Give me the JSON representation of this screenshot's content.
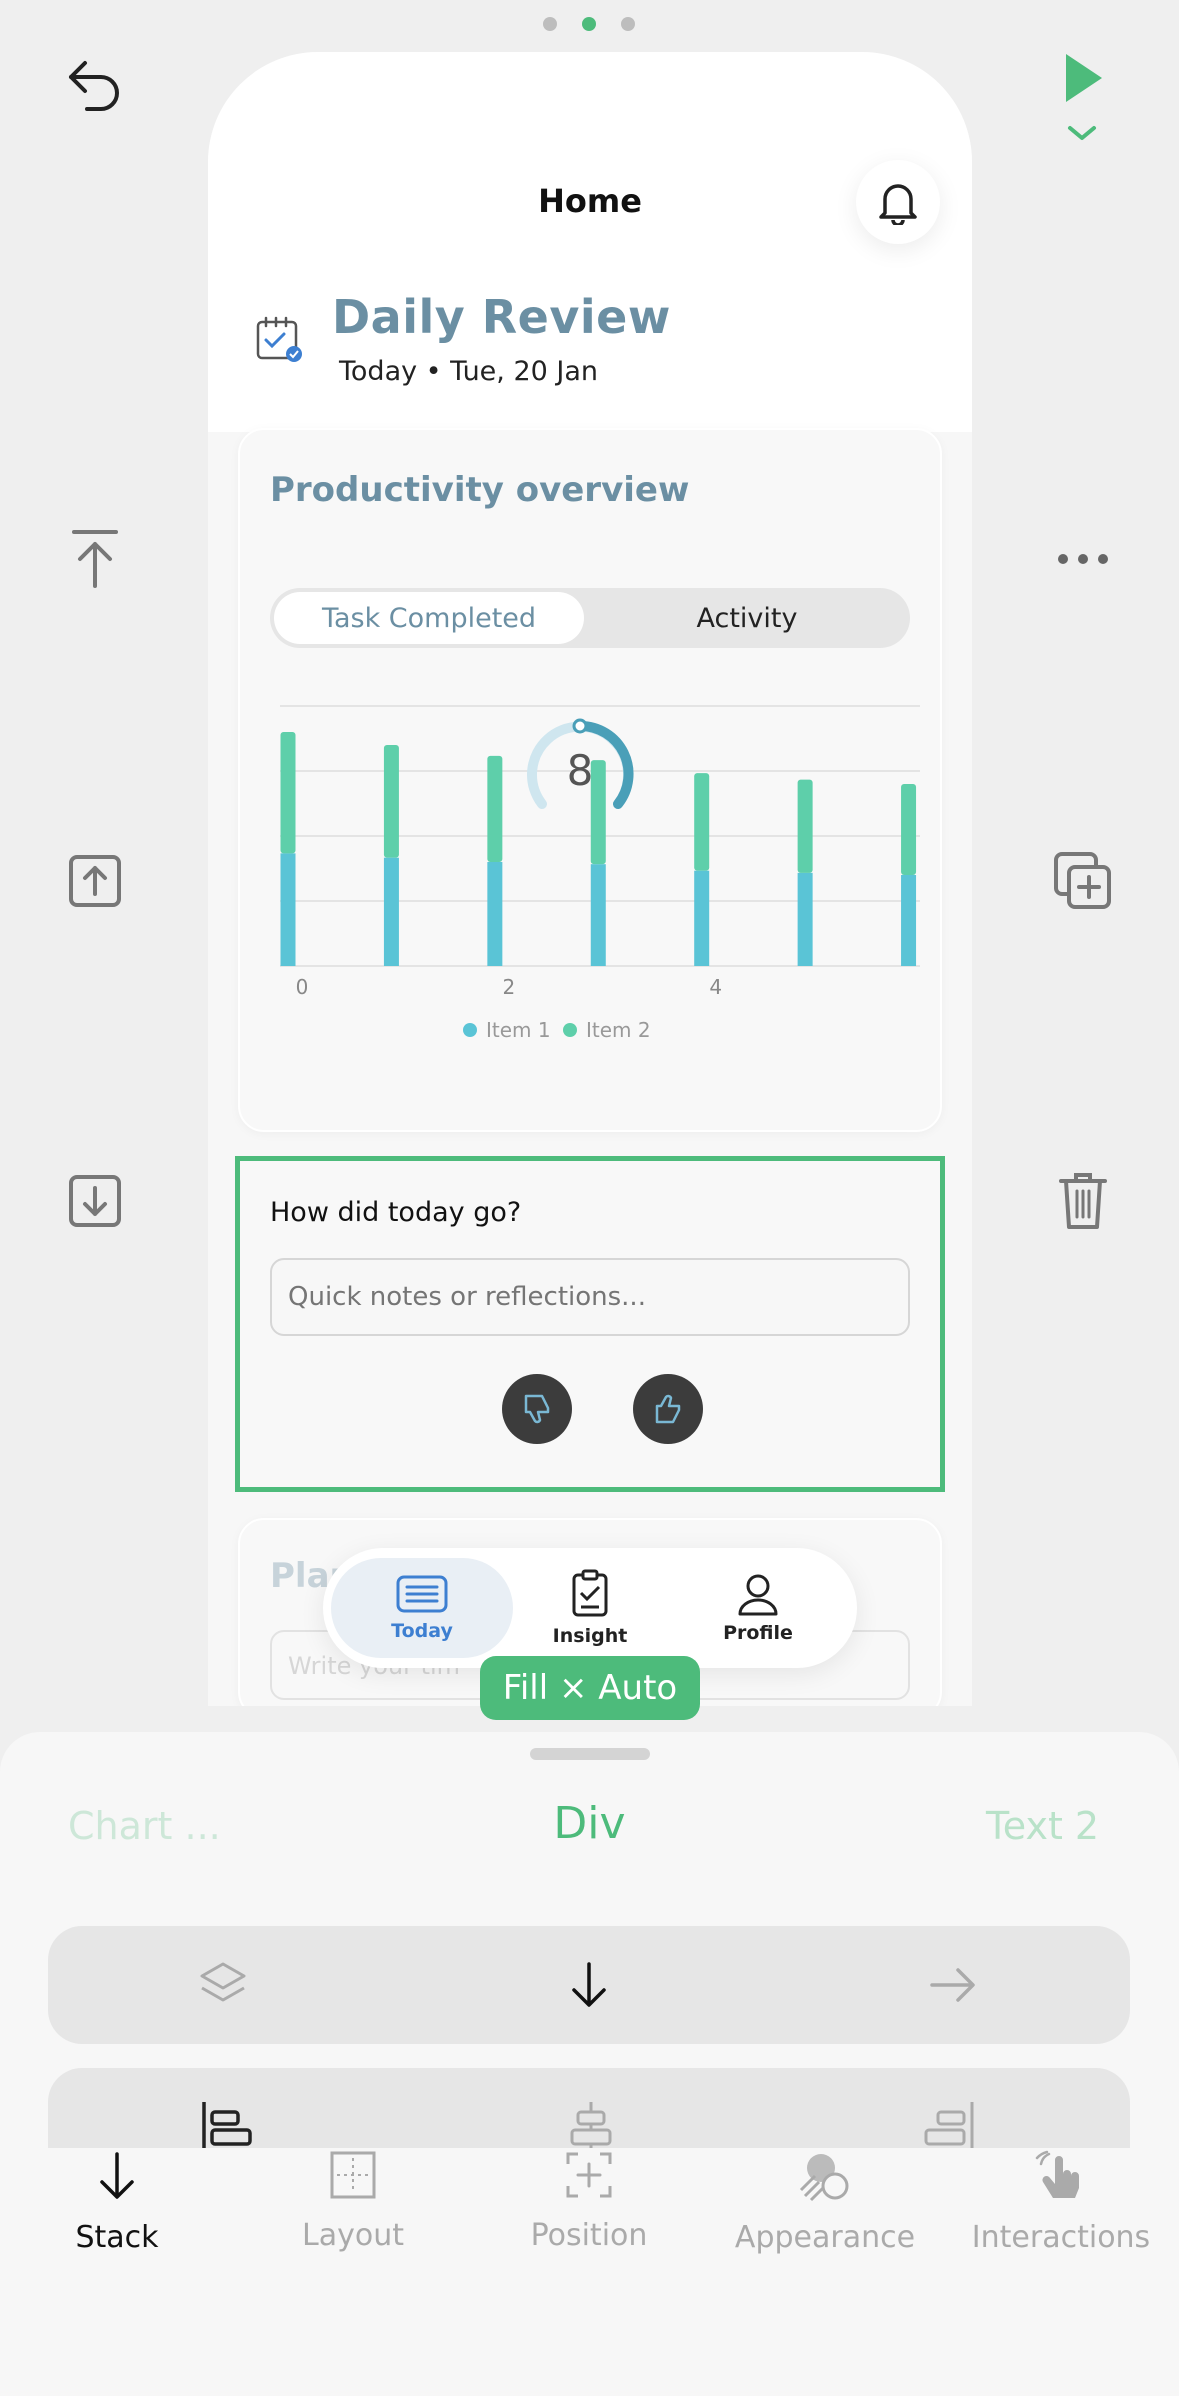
{
  "phone": {
    "header_title": "Home",
    "review_title": "Daily Review",
    "review_date": "Today • Tue, 20 Jan"
  },
  "overview": {
    "title": "Productivity overview",
    "segments": [
      "Task Completed",
      "Activity"
    ],
    "selected_segment": "Task Completed",
    "gauge_value": "8"
  },
  "chart_data": {
    "type": "bar",
    "x": [
      0,
      1,
      2,
      3,
      4,
      5,
      6
    ],
    "xticks": [
      "0",
      "2",
      "4"
    ],
    "series": [
      {
        "name": "Item 1",
        "color": "#5ac4d6",
        "values": [
          5.2,
          5.0,
          4.8,
          4.7,
          4.4,
          4.3,
          4.2
        ]
      },
      {
        "name": "Item 2",
        "color": "#5ecfaa",
        "values": [
          5.6,
          5.2,
          4.9,
          4.8,
          4.5,
          4.3,
          4.2
        ]
      }
    ],
    "ylim": [
      0,
      12
    ],
    "grid": true,
    "legend": "bottom"
  },
  "reflection": {
    "question": "How did today go?",
    "placeholder": "Quick notes or reflections..."
  },
  "plan_card": {
    "title_partial": "Plar",
    "placeholder_partial": "Write your tim"
  },
  "nav": {
    "items": [
      "Today",
      "Insight",
      "Profile"
    ],
    "active": "Today"
  },
  "badge": "Fill × Auto",
  "sheet": {
    "prev_crumb": "Chart ...",
    "current_crumb": "Div",
    "next_crumb": "Text 2"
  },
  "tabs": [
    "Stack",
    "Layout",
    "Position",
    "Appearance",
    "Interactions"
  ],
  "active_tab": "Stack",
  "colors": {
    "accent_green": "#4dbb7b",
    "title_blue": "#6b8fa3",
    "bar_teal": "#5ac4d6",
    "bar_green": "#5ecfaa"
  }
}
